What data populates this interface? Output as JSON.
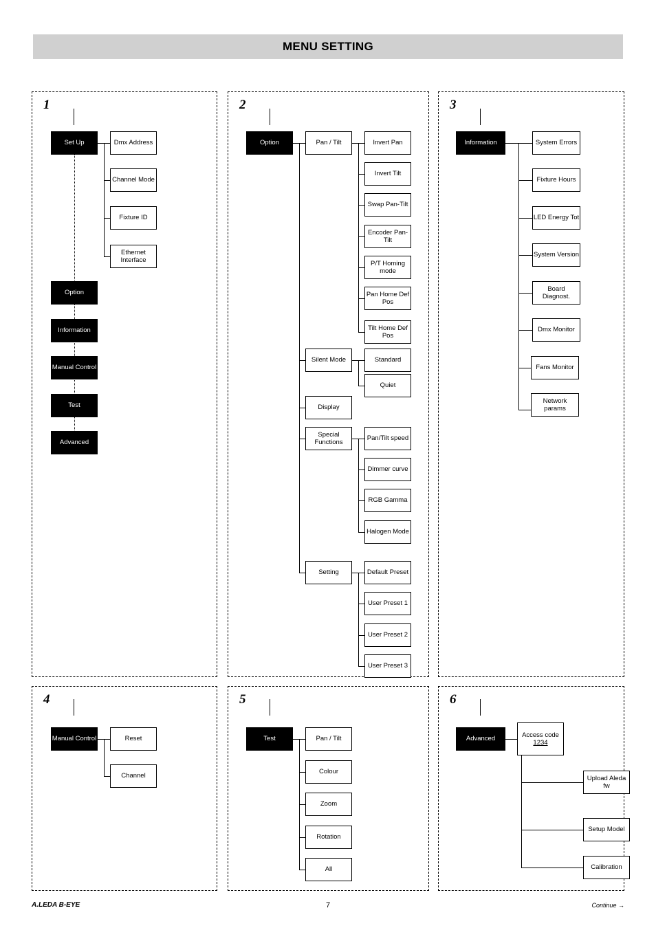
{
  "header": {
    "title": "MENU SETTING"
  },
  "footer": {
    "product": "A.LEDA B-EYE",
    "page_number": "7",
    "continue_label": "Continue →"
  },
  "panels": [
    {
      "number": "1",
      "root": "Set Up",
      "children": [
        "Dmx Address",
        "Channel Mode",
        "Fixture ID",
        "Ethernet Interface"
      ],
      "main_menu": [
        "Set Up",
        "Option",
        "Information",
        "Manual Control",
        "Test",
        "Advanced"
      ]
    },
    {
      "number": "2",
      "root": "Option",
      "level2": [
        "Pan / Tilt",
        "Silent Mode",
        "Display",
        "Special Functions",
        "Setting"
      ],
      "pan_tilt_children": [
        "Invert Pan",
        "Invert Tilt",
        "Swap Pan-Tilt",
        "Encoder Pan-Tilt",
        "P/T Homing mode",
        "Pan Home Def Pos",
        "Tilt Home Def Pos"
      ],
      "silent_mode_children": [
        "Standard",
        "Quiet"
      ],
      "special_functions_children": [
        "Pan/Tilt speed",
        "Dimmer curve",
        "RGB Gamma",
        "Halogen Mode"
      ],
      "setting_children": [
        "Default Preset",
        "User Preset 1",
        "User Preset 2",
        "User Preset 3"
      ]
    },
    {
      "number": "3",
      "root": "Information",
      "children": [
        "System Errors",
        "Fixture Hours",
        "LED Energy Tot",
        "System Version",
        "Board Diagnost.",
        "Dmx Monitor",
        "Fans Monitor",
        "Network params"
      ]
    },
    {
      "number": "4",
      "root": "Manual Control",
      "children": [
        "Reset",
        "Channel"
      ]
    },
    {
      "number": "5",
      "root": "Test",
      "children": [
        "Pan / Tilt",
        "Colour",
        "Zoom",
        "Rotation",
        "All"
      ]
    },
    {
      "number": "6",
      "root": "Advanced",
      "access_code_label": "Access code",
      "access_code_value": "1234",
      "children": [
        "Upload Aleda fw",
        "Setup Model",
        "Calibration"
      ]
    }
  ],
  "colors": {
    "header_bg": "#d0d0d0",
    "node_black": "#000000",
    "node_white": "#ffffff",
    "text": "#000000"
  }
}
